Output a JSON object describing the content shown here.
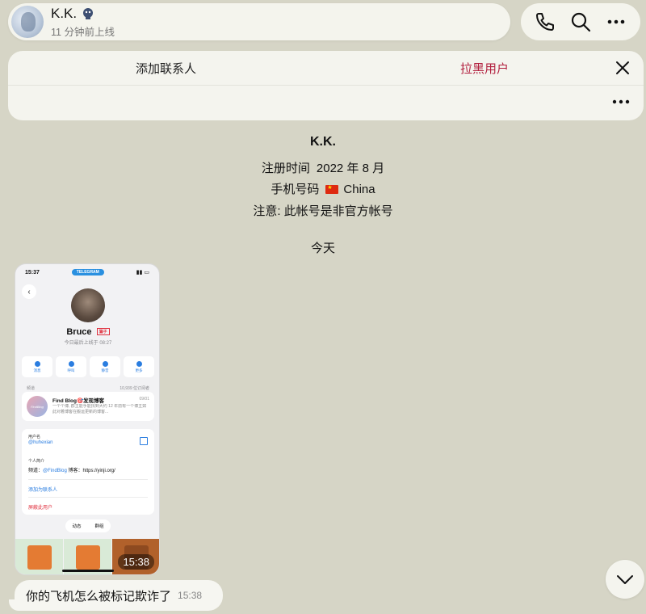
{
  "header": {
    "name": "K.K.",
    "status": "11 分钟前上线"
  },
  "actions": {
    "call_icon": "phone-icon",
    "search_icon": "search-icon",
    "more_icon": "more-icon"
  },
  "contact_bar": {
    "add_contact": "添加联系人",
    "block_user": "拉黑用户"
  },
  "peer_info": {
    "name": "K.K.",
    "registered_label": "注册时间",
    "registered_value": "2022 年 8 月",
    "phone_label": "手机号码",
    "phone_value": "China",
    "note": "注意: 此帐号是非官方帐号"
  },
  "date_separator": "今天",
  "screenshot": {
    "status_time": "15:37",
    "telegram_pill": "TELEGRAM",
    "profile_name": "Bruce",
    "badge": "骗子",
    "last_seen": "今日最后上线于 08:27",
    "buttons": [
      "消息",
      "呼叫",
      "静音",
      "更多"
    ],
    "channel_label": "频道",
    "channel_subs": "10,939 位订阅者",
    "channel_title": "Find Blog🎯发现博客",
    "channel_time": "09/01",
    "channel_desc": "一个个博, 群主能手能找到大约 12 年前有一个博主如此对着博客在搬运更新的博客...",
    "channel_logo": "FindBlog",
    "username_label": "用户名",
    "username_value": "@huhexian",
    "bio_label": "个人简介",
    "bio_prefix": "频道：",
    "bio_link": "@FindBlog",
    "bio_suffix": " 博客：https://yinji.org/",
    "add_contact": "添加为联系人",
    "block_user": "屏蔽此用户",
    "seg_posts": "动态",
    "seg_groups": "群组",
    "message_time": "15:38"
  },
  "message": {
    "text": "你的飞机怎么被标记欺诈了",
    "time": "15:38"
  }
}
